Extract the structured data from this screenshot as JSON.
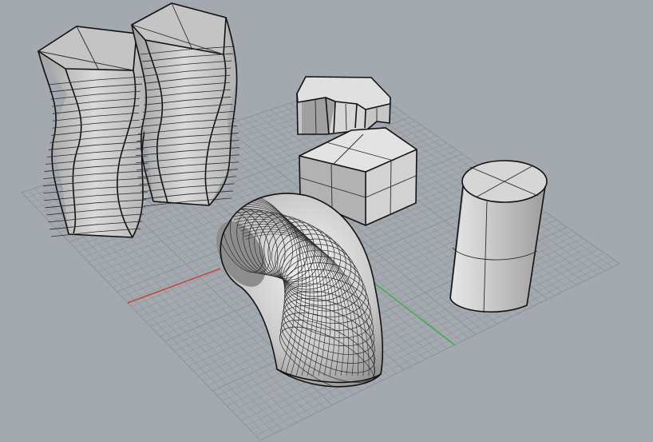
{
  "viewport": {
    "background": "#a4a9b0",
    "grid_color": "#8f949b",
    "x_axis_color": "#c2483c",
    "y_axis_color": "#3cae4c",
    "surface_fill": "#c8c8c8",
    "surface_light": "#dcdcdc",
    "surface_dark": "#a9a9a9",
    "edge_color": "#111111",
    "isocurve_color": "#2a2a2a"
  },
  "scene": {
    "objects": [
      {
        "name": "twisted-prism-left",
        "kind": "twisted polygonal extrusion"
      },
      {
        "name": "twisted-prism-right",
        "kind": "twisted polygonal extrusion"
      },
      {
        "name": "notched-prism",
        "kind": "polygonal extrusion with notch"
      },
      {
        "name": "box",
        "kind": "box"
      },
      {
        "name": "pipe-elbow",
        "kind": "bent tube"
      },
      {
        "name": "cylinder",
        "kind": "cylinder"
      }
    ]
  }
}
